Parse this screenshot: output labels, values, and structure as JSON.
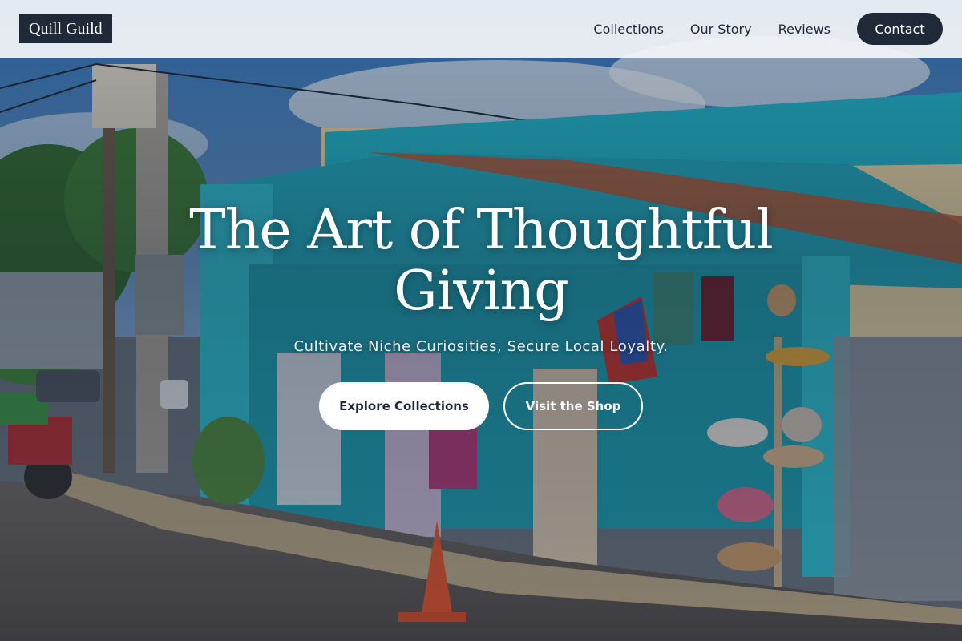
{
  "navbar": {
    "logo": "Quill Guild",
    "links": [
      {
        "label": "Collections"
      },
      {
        "label": "Our Story"
      },
      {
        "label": "Reviews"
      }
    ],
    "cta_label": "Contact"
  },
  "hero": {
    "title": "The Art of Thoughtful Giving",
    "subtitle": "Cultivate Niche Curiosities, Secure Local Loyalty.",
    "primary_button": "Explore Collections",
    "secondary_button": "Visit the Shop",
    "background_image": "colorful-roadside-souvenir-shop"
  },
  "colors": {
    "brand_dark": "#1f2937",
    "navbar_bg": "#f3f5f8",
    "hero_text": "#ffffff",
    "shop_accent": "#1fb5c9"
  }
}
